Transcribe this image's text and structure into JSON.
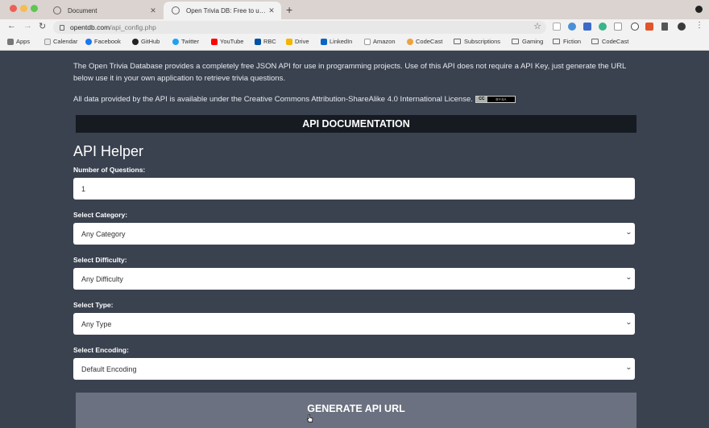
{
  "browser": {
    "tabs": [
      {
        "title": "Document"
      },
      {
        "title": "Open Trivia DB: Free to use, us"
      }
    ],
    "url_host": "opentdb.com",
    "url_path": "/api_config.php",
    "bookmarks": [
      "Apps",
      "Calendar",
      "Facebook",
      "GitHub",
      "Twitter",
      "YouTube",
      "RBC",
      "Drive",
      "LinkedIn",
      "Amazon",
      "CodeCast",
      "Subscriptions",
      "Gaming",
      "Fiction",
      "CodeCast"
    ]
  },
  "page": {
    "intro": "The Open Trivia Database provides a completely free JSON API for use in programming projects. Use of this API does not require a API Key, just generate the URL below use it in your own application to retrieve trivia questions.",
    "license": "All data provided by the API is available under the Creative Commons Attribution-ShareAlike 4.0 International License.",
    "license_badge": {
      "left": "CC",
      "right": "BY-SA"
    },
    "doc_banner": "API DOCUMENTATION",
    "helper_title": "API Helper",
    "fields": [
      {
        "label": "Number of Questions:",
        "value": "1"
      },
      {
        "label": "Select Category:",
        "value": "Any Category"
      },
      {
        "label": "Select Difficulty:",
        "value": "Any Difficulty"
      },
      {
        "label": "Select Type:",
        "value": "Any Type"
      },
      {
        "label": "Select Encoding:",
        "value": "Default Encoding"
      }
    ],
    "generate_button": "GENERATE API URL"
  },
  "colors": {
    "page_bg": "#3a4250",
    "banner_bg": "#161b22",
    "button_bg": "#6b7180"
  }
}
